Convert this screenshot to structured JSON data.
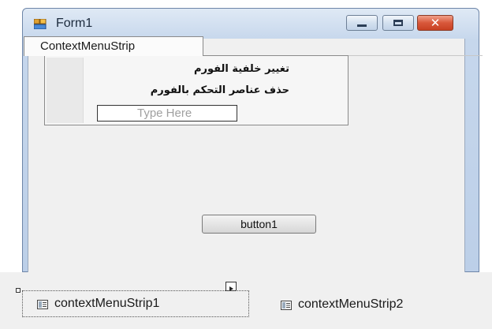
{
  "window": {
    "title": "Form1"
  },
  "context_menu_strip": {
    "tab_label": "ContextMenuStrip",
    "items": [
      {
        "label": "تغيير خلفية الفورم"
      },
      {
        "label": "حذف عناصر التحكم بالفورم"
      }
    ],
    "type_here_placeholder": "Type Here"
  },
  "form": {
    "button_label": "button1"
  },
  "component_tray": {
    "items": [
      {
        "label": "contextMenuStrip1",
        "selected": true
      },
      {
        "label": "contextMenuStrip2",
        "selected": false
      }
    ]
  },
  "colors": {
    "window_frame": "#6e86a8",
    "close_button": "#d8573a",
    "client_background": "#f0f0f0"
  },
  "icons": [
    "form-app-icon",
    "minimize-icon",
    "maximize-icon",
    "close-icon",
    "component-icon",
    "smart-tag-icon"
  ]
}
